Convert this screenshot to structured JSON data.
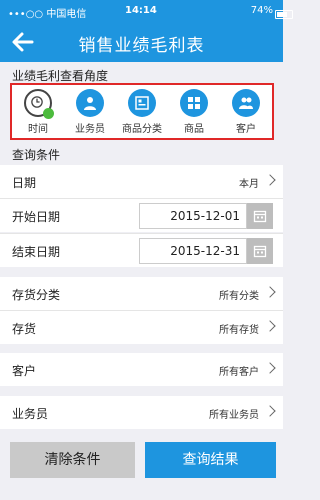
{
  "status": {
    "carrier": "•••○○ 中国电信",
    "time": "14:14",
    "battery": "74%"
  },
  "nav": {
    "title": "销售业绩毛利表"
  },
  "dimension_section": {
    "title": "业绩毛利查看角度",
    "items": [
      {
        "label": "时间",
        "icon": "clock-icon",
        "selected": true
      },
      {
        "label": "业务员",
        "icon": "salesperson-icon",
        "selected": false
      },
      {
        "label": "商品分类",
        "icon": "category-icon",
        "selected": false
      },
      {
        "label": "商品",
        "icon": "product-icon",
        "selected": false
      },
      {
        "label": "客户",
        "icon": "customer-icon",
        "selected": false
      }
    ]
  },
  "query_section": {
    "title": "查询条件"
  },
  "fields": {
    "date": {
      "label": "日期",
      "value": "本月"
    },
    "start_date": {
      "label": "开始日期",
      "value": "2015-12-01"
    },
    "end_date": {
      "label": "结束日期",
      "value": "2015-12-31"
    },
    "inventory_category": {
      "label": "存货分类",
      "value": "所有分类"
    },
    "inventory": {
      "label": "存货",
      "value": "所有存货"
    },
    "customer": {
      "label": "客户",
      "value": "所有客户"
    },
    "salesperson": {
      "label": "业务员",
      "value": "所有业务员"
    }
  },
  "buttons": {
    "clear": "清除条件",
    "query": "查询结果"
  },
  "colors": {
    "primary": "#1e95df",
    "highlight_border": "#e02828",
    "check": "#4cbb3d"
  }
}
